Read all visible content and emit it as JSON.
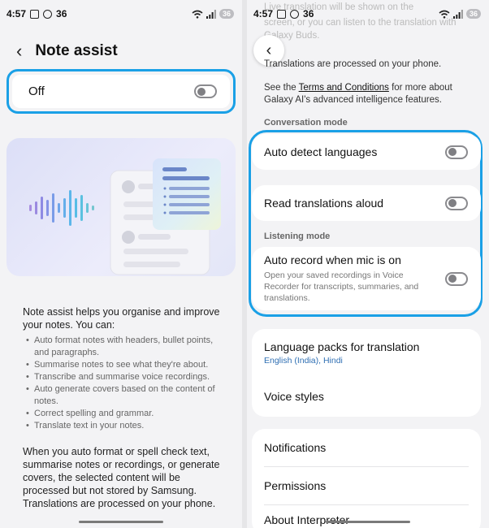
{
  "left": {
    "status": {
      "time": "4:57",
      "count": "36",
      "battery": "36"
    },
    "title": "Note assist",
    "off_label": "Off",
    "intro": "Note assist helps you organise and improve your notes. You can:",
    "bullets": [
      "Auto format notes with headers, bullet points, and paragraphs.",
      "Summarise notes to see what they're about.",
      "Transcribe and summarise voice recordings.",
      "Auto generate covers based on the content of notes.",
      "Correct spelling and grammar.",
      "Translate text in your notes."
    ],
    "disclaimer": "When you auto format or spell check text, summarise notes or recordings, or generate covers, the selected content will be processed but not stored by Samsung. Translations are processed on your phone."
  },
  "right": {
    "status": {
      "time": "4:57",
      "count": "36",
      "battery": "36"
    },
    "top_faded_1": "Live translation will be shown on the",
    "top_faded_2": "screen, or you can listen to the translation with",
    "top_faded_3": "Galaxy Buds.",
    "processed": "Translations are processed on your phone.",
    "terms_prefix": "See the ",
    "terms_link": "Terms and Conditions",
    "terms_suffix": " for more about Galaxy AI's advanced intelligence features.",
    "conversation_mode_label": "Conversation mode",
    "auto_detect": "Auto detect languages",
    "read_aloud": "Read translations aloud",
    "listening_mode_label": "Listening mode",
    "auto_record_title": "Auto record when mic is on",
    "auto_record_sub": "Open your saved recordings in Voice Recorder for transcripts, summaries, and translations.",
    "lang_packs_title": "Language packs for translation",
    "lang_packs_sub": "English (India), Hindi",
    "voice_styles": "Voice styles",
    "notifications": "Notifications",
    "permissions": "Permissions",
    "about": "About Interpreter"
  },
  "colors": {
    "highlight": "#1aa0e6",
    "link": "#2f6fb3"
  },
  "icons": [
    "back-arrow-icon",
    "toggle-switch",
    "wifi-icon",
    "signal-icon",
    "battery-icon"
  ]
}
